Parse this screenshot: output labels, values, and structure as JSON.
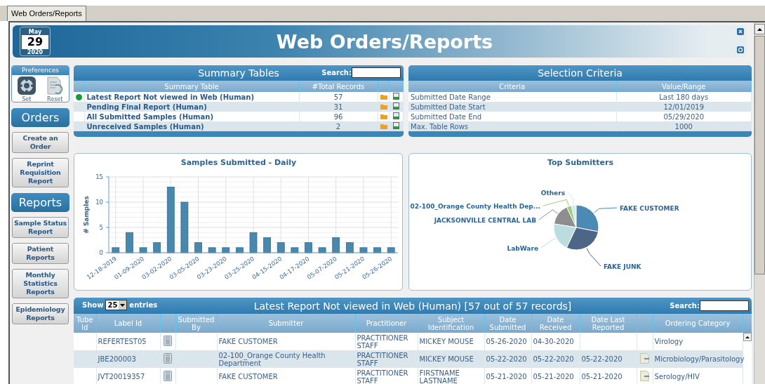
{
  "tab": {
    "label": "Web Orders/Reports",
    "selected": true
  },
  "calendar": {
    "month": "May",
    "day": "29",
    "year": "2020"
  },
  "title": "Web Orders/Reports",
  "preferences": {
    "title": "Preferences",
    "buttons": [
      {
        "kind": "set",
        "label": "Set"
      },
      {
        "kind": "reset",
        "label": "Reset"
      }
    ]
  },
  "sidebar": {
    "sections": [
      {
        "title": "Orders",
        "items": [
          "Create an Order",
          "Reprint Requisition Report"
        ]
      },
      {
        "title": "Reports",
        "items": [
          "Sample Status Report",
          "Patient Reports",
          "Monthly Statistics Reports",
          "Epidemiology Reports"
        ]
      }
    ]
  },
  "summary": {
    "title": "Summary Tables",
    "search_label": "Search:",
    "columns": [
      "Summary Table",
      "#Total Records"
    ],
    "rows": [
      {
        "name": "Latest Report Not viewed in Web (Human)",
        "count": "57",
        "flagged": true
      },
      {
        "name": "Pending Final Report (Human)",
        "count": "31",
        "flagged": false
      },
      {
        "name": "All Submitted Samples (Human)",
        "count": "96",
        "flagged": false
      },
      {
        "name": "Unreceived Samples (Human)",
        "count": "2",
        "flagged": false
      }
    ]
  },
  "selection_criteria": {
    "title": "Selection Criteria",
    "columns": [
      "Criteria",
      "Value/Range"
    ],
    "rows": [
      {
        "criteria": "Submitted Date Range",
        "value": "Last 180 days"
      },
      {
        "criteria": "Submitted Date Start",
        "value": "12/01/2019"
      },
      {
        "criteria": "Submitted Date End",
        "value": "05/29/2020"
      },
      {
        "criteria": "Max. Table Rows",
        "value": "1000"
      }
    ]
  },
  "daily_chart": {
    "chart_data": {
      "type": "bar",
      "title": "Samples Submitted - Daily",
      "ylabel": "# Samples",
      "categories": [
        "12-18-2019",
        null,
        "01-09-2020",
        null,
        "03-02-2020",
        null,
        "03-05-2020",
        null,
        "03-23-2020",
        null,
        "03-25-2020",
        null,
        "04-15-2020",
        null,
        "04-17-2020",
        null,
        "05-07-2020",
        null,
        "05-21-2020",
        null,
        "05-26-2020"
      ],
      "values": [
        1,
        4,
        1,
        2,
        13,
        10,
        2,
        1,
        1,
        1,
        4,
        3,
        2,
        1,
        2,
        1,
        3,
        2,
        1,
        1,
        1
      ],
      "ylim": [
        0,
        15
      ],
      "yticks": [
        0,
        5,
        10,
        15
      ],
      "grid": true
    }
  },
  "top_submitters": {
    "title": "Top Submitters",
    "slices": [
      {
        "label": "Others",
        "color": "#cfeaf7"
      },
      {
        "label": "02-100_Orange County Health Dep...",
        "color": "#9ad17a"
      },
      {
        "label": "FAKE CUSTOMER",
        "color": "#4a8ab5"
      },
      {
        "label": "JACKSONVILLE CENTRAL LAB",
        "color": "#8e8e8e"
      },
      {
        "label": "LabWare",
        "color": "#bcdde0"
      },
      {
        "label": "FAKE JUNK",
        "color": "#4d6587"
      }
    ]
  },
  "report_table": {
    "show_label": "Show",
    "page_size": "25",
    "entries_label": "entries",
    "title": "Latest Report Not viewed in Web (Human) [57 out of 57 records]",
    "search_label": "Search:",
    "columns": [
      "Tube Id",
      "Label Id",
      "Submitted By",
      "Submitter",
      "Practitioner",
      "Subject Identification",
      "Date Submitted",
      "Date Received",
      "Date Last Reported",
      "Ordering Category"
    ],
    "rows": [
      {
        "label_id": "REFERTEST05",
        "submitter": "FAKE CUSTOMER",
        "practitioner": "PRACTITIONER STAFF",
        "subject": "MICKEY MOUSE",
        "date_submitted": "05-26-2020",
        "date_received": "04-30-2020",
        "has_report": false,
        "ordering_category": "Virology"
      },
      {
        "label_id": "JBE200003",
        "submitter": "02-100_Orange County Health Department",
        "practitioner": "PRACTITIONER STAFF",
        "subject": "MICKEY MOUSE",
        "date_submitted": "05-22-2020",
        "date_received": "05-22-2020",
        "date_last_reported": "05-22-2020",
        "has_report": true,
        "ordering_category": "Microbiology/Parasitology"
      },
      {
        "label_id": "JVT20019357",
        "submitter": "FAKE CUSTOMER",
        "practitioner": "PRACTITIONER STAFF",
        "subject": "FIRSTNAME LASTNAME",
        "date_submitted": "05-21-2020",
        "date_received": "05-21-2020",
        "date_last_reported": "05-21-2020",
        "has_report": true,
        "ordering_category": "Serology/HIV"
      }
    ]
  }
}
